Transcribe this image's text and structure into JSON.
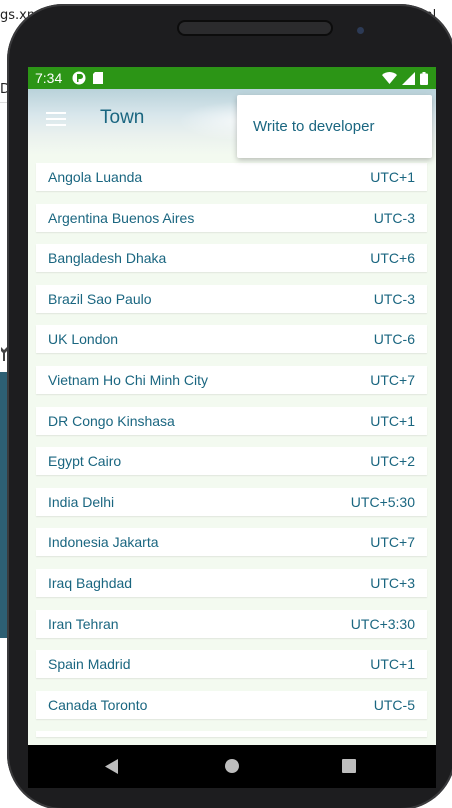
{
  "background": {
    "ide_text_top_left": "gs.xml",
    "ide_text_top_right": "ml",
    "ide_text_left2": "De"
  },
  "status": {
    "time": "7:34",
    "bar_color": "#2c9516"
  },
  "toolbar": {
    "title": "Town"
  },
  "overflow_menu": {
    "items": [
      "Write to developer"
    ]
  },
  "towns": [
    {
      "name": "Angola Luanda",
      "utc": "UTC+1"
    },
    {
      "name": "Argentina Buenos Aires",
      "utc": "UTC-3"
    },
    {
      "name": "Bangladesh Dhaka",
      "utc": "UTC+6"
    },
    {
      "name": "Brazil Sao Paulo",
      "utc": "UTC-3"
    },
    {
      "name": "UK London",
      "utc": "UTC-6"
    },
    {
      "name": "Vietnam Ho Chi Minh City",
      "utc": "UTC+7"
    },
    {
      "name": "DR Congo Kinshasa",
      "utc": "UTC+1"
    },
    {
      "name": "Egypt Cairo",
      "utc": "UTC+2"
    },
    {
      "name": "India Delhi",
      "utc": "UTC+5:30"
    },
    {
      "name": "Indonesia Jakarta",
      "utc": "UTC+7"
    },
    {
      "name": "Iraq Baghdad",
      "utc": "UTC+3"
    },
    {
      "name": "Iran Tehran",
      "utc": "UTC+3:30"
    },
    {
      "name": "Spain Madrid",
      "utc": "UTC+1"
    },
    {
      "name": "Canada Toronto",
      "utc": "UTC-5"
    }
  ],
  "colors": {
    "accent_text": "#1a6680",
    "list_background": "#f3faf0"
  },
  "nav_icons": [
    "back-icon",
    "home-icon",
    "recents-icon"
  ]
}
